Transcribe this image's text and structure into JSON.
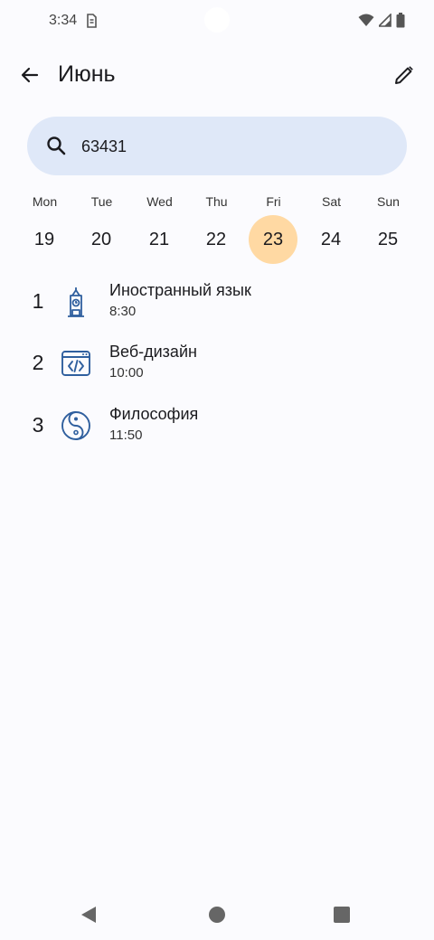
{
  "status_bar": {
    "time": "3:34"
  },
  "app_bar": {
    "title": "Июнь"
  },
  "search": {
    "value": "63431"
  },
  "week": {
    "days": [
      {
        "name": "Mon",
        "num": "19"
      },
      {
        "name": "Tue",
        "num": "20"
      },
      {
        "name": "Wed",
        "num": "21"
      },
      {
        "name": "Thu",
        "num": "22"
      },
      {
        "name": "Fri",
        "num": "23"
      },
      {
        "name": "Sat",
        "num": "24"
      },
      {
        "name": "Sun",
        "num": "25"
      }
    ],
    "selected_day": "Fri"
  },
  "lessons": [
    {
      "index": "1",
      "name": "Иностранный язык",
      "time": "8:30",
      "icon": "big-ben-icon"
    },
    {
      "index": "2",
      "name": "Веб-дизайн",
      "time": "10:00",
      "icon": "code-window-icon"
    },
    {
      "index": "3",
      "name": "Философия",
      "time": "11:50",
      "icon": "yin-yang-icon"
    }
  ],
  "colors": {
    "background": "#FBFBFE",
    "search_bg": "#DFE8F8",
    "selected_day": "#FFD9A3",
    "icon_blue": "#2F5F9E"
  }
}
